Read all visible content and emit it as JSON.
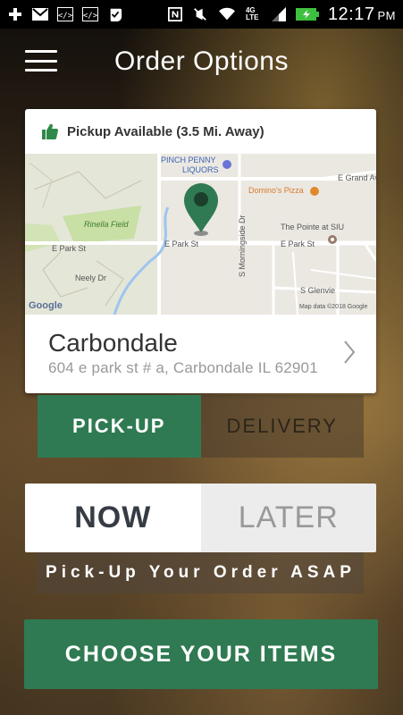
{
  "status_bar": {
    "time": "12:17",
    "ampm": "PM",
    "network": "4G LTE",
    "icons": [
      "plus-icon",
      "gmail-icon",
      "code-icon",
      "code-icon",
      "check-icon",
      "nfc-icon",
      "mute-icon",
      "wifi-icon",
      "signal-icon",
      "battery-icon"
    ]
  },
  "header": {
    "title": "Order Options",
    "menu_icon": "hamburger-menu-icon"
  },
  "location_card": {
    "availability": "Pickup Available (3.5 Mi. Away)",
    "map": {
      "labels": {
        "pinch_penny": "PINCH PENNY",
        "liquors": "LIQUORS",
        "dominos": "Domino's Pizza",
        "grand_ave": "E Grand Av",
        "rinella": "Rinella Field",
        "park_st_1": "E Park St",
        "park_st_2": "E Park St",
        "park_st_3": "E Park St",
        "pointe": "The Pointe at SIU",
        "neely": "Neely Dr",
        "morningside": "S Morningside Dr",
        "glenview": "S Glenvie",
        "google": "Google",
        "map_data": "Map data ©2018 Google"
      }
    },
    "city": "Carbondale",
    "address": "604 e park st # a, Carbondale IL 62901"
  },
  "order_type": {
    "pickup": "PICK-UP",
    "delivery": "DELIVERY",
    "selected": "pickup"
  },
  "order_time": {
    "now": "NOW",
    "later": "LATER",
    "selected": "now",
    "description": "Pick-Up Your Order ASAP"
  },
  "cta": {
    "label": "CHOOSE YOUR ITEMS"
  },
  "colors": {
    "accent_green": "#2f7a52",
    "thumb_green": "#2f8a4a"
  }
}
